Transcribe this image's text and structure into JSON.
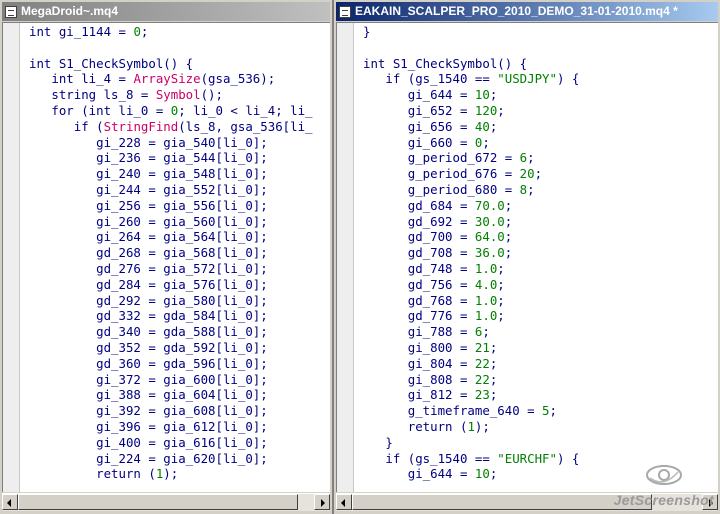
{
  "left_window": {
    "title": "MegaDroid~.mq4",
    "lines": [
      [
        [
          "kw",
          "int gi_1144 = "
        ],
        [
          "num",
          "0"
        ],
        [
          "kw",
          ";"
        ]
      ],
      [],
      [
        [
          "kw",
          "int S1_CheckSymbol() {"
        ]
      ],
      [
        [
          "kw",
          "   int li_4 = "
        ],
        [
          "fn",
          "ArraySize"
        ],
        [
          "kw",
          "(gsa_536);"
        ]
      ],
      [
        [
          "kw",
          "   string ls_8 = "
        ],
        [
          "fn",
          "Symbol"
        ],
        [
          "kw",
          "();"
        ]
      ],
      [
        [
          "kw",
          "   for (int li_0 = "
        ],
        [
          "num",
          "0"
        ],
        [
          "kw",
          "; li_0 < li_4; li_"
        ]
      ],
      [
        [
          "kw",
          "      if ("
        ],
        [
          "fn",
          "StringFind"
        ],
        [
          "kw",
          "(ls_8, gsa_536[li_"
        ]
      ],
      [
        [
          "kw",
          "         gi_228 = gia_540[li_0];"
        ]
      ],
      [
        [
          "kw",
          "         gi_236 = gia_544[li_0];"
        ]
      ],
      [
        [
          "kw",
          "         gi_240 = gia_548[li_0];"
        ]
      ],
      [
        [
          "kw",
          "         gi_244 = gia_552[li_0];"
        ]
      ],
      [
        [
          "kw",
          "         gi_256 = gia_556[li_0];"
        ]
      ],
      [
        [
          "kw",
          "         gi_260 = gia_560[li_0];"
        ]
      ],
      [
        [
          "kw",
          "         gi_264 = gia_564[li_0];"
        ]
      ],
      [
        [
          "kw",
          "         gd_268 = gia_568[li_0];"
        ]
      ],
      [
        [
          "kw",
          "         gd_276 = gia_572[li_0];"
        ]
      ],
      [
        [
          "kw",
          "         gd_284 = gia_576[li_0];"
        ]
      ],
      [
        [
          "kw",
          "         gd_292 = gia_580[li_0];"
        ]
      ],
      [
        [
          "kw",
          "         gd_332 = gda_584[li_0];"
        ]
      ],
      [
        [
          "kw",
          "         gd_340 = gda_588[li_0];"
        ]
      ],
      [
        [
          "kw",
          "         gd_352 = gda_592[li_0];"
        ]
      ],
      [
        [
          "kw",
          "         gd_360 = gda_596[li_0];"
        ]
      ],
      [
        [
          "kw",
          "         gi_372 = gia_600[li_0];"
        ]
      ],
      [
        [
          "kw",
          "         gi_388 = gia_604[li_0];"
        ]
      ],
      [
        [
          "kw",
          "         gi_392 = gia_608[li_0];"
        ]
      ],
      [
        [
          "kw",
          "         gi_396 = gia_612[li_0];"
        ]
      ],
      [
        [
          "kw",
          "         gi_400 = gia_616[li_0];"
        ]
      ],
      [
        [
          "kw",
          "         gi_224 = gia_620[li_0];"
        ]
      ],
      [
        [
          "kw",
          "         return ("
        ],
        [
          "num",
          "1"
        ],
        [
          "kw",
          ");"
        ]
      ]
    ]
  },
  "right_window": {
    "title": "EAKAIN_SCALPER_PRO_2010_DEMO_31-01-2010.mq4 *",
    "lines": [
      [
        [
          "kw",
          "}"
        ]
      ],
      [],
      [
        [
          "kw",
          "int S1_CheckSymbol() {"
        ]
      ],
      [
        [
          "kw",
          "   if (gs_1540 == "
        ],
        [
          "str",
          "\"USDJPY\""
        ],
        [
          "kw",
          ") {"
        ]
      ],
      [
        [
          "kw",
          "      gi_644 = "
        ],
        [
          "num",
          "10"
        ],
        [
          "kw",
          ";"
        ]
      ],
      [
        [
          "kw",
          "      gi_652 = "
        ],
        [
          "num",
          "120"
        ],
        [
          "kw",
          ";"
        ]
      ],
      [
        [
          "kw",
          "      gi_656 = "
        ],
        [
          "num",
          "40"
        ],
        [
          "kw",
          ";"
        ]
      ],
      [
        [
          "kw",
          "      gi_660 = "
        ],
        [
          "num",
          "0"
        ],
        [
          "kw",
          ";"
        ]
      ],
      [
        [
          "kw",
          "      g_period_672 = "
        ],
        [
          "num",
          "6"
        ],
        [
          "kw",
          ";"
        ]
      ],
      [
        [
          "kw",
          "      g_period_676 = "
        ],
        [
          "num",
          "20"
        ],
        [
          "kw",
          ";"
        ]
      ],
      [
        [
          "kw",
          "      g_period_680 = "
        ],
        [
          "num",
          "8"
        ],
        [
          "kw",
          ";"
        ]
      ],
      [
        [
          "kw",
          "      gd_684 = "
        ],
        [
          "num",
          "70.0"
        ],
        [
          "kw",
          ";"
        ]
      ],
      [
        [
          "kw",
          "      gd_692 = "
        ],
        [
          "num",
          "30.0"
        ],
        [
          "kw",
          ";"
        ]
      ],
      [
        [
          "kw",
          "      gd_700 = "
        ],
        [
          "num",
          "64.0"
        ],
        [
          "kw",
          ";"
        ]
      ],
      [
        [
          "kw",
          "      gd_708 = "
        ],
        [
          "num",
          "36.0"
        ],
        [
          "kw",
          ";"
        ]
      ],
      [
        [
          "kw",
          "      gd_748 = "
        ],
        [
          "num",
          "1.0"
        ],
        [
          "kw",
          ";"
        ]
      ],
      [
        [
          "kw",
          "      gd_756 = "
        ],
        [
          "num",
          "4.0"
        ],
        [
          "kw",
          ";"
        ]
      ],
      [
        [
          "kw",
          "      gd_768 = "
        ],
        [
          "num",
          "1.0"
        ],
        [
          "kw",
          ";"
        ]
      ],
      [
        [
          "kw",
          "      gd_776 = "
        ],
        [
          "num",
          "1.0"
        ],
        [
          "kw",
          ";"
        ]
      ],
      [
        [
          "kw",
          "      gi_788 = "
        ],
        [
          "num",
          "6"
        ],
        [
          "kw",
          ";"
        ]
      ],
      [
        [
          "kw",
          "      gi_800 = "
        ],
        [
          "num",
          "21"
        ],
        [
          "kw",
          ";"
        ]
      ],
      [
        [
          "kw",
          "      gi_804 = "
        ],
        [
          "num",
          "22"
        ],
        [
          "kw",
          ";"
        ]
      ],
      [
        [
          "kw",
          "      gi_808 = "
        ],
        [
          "num",
          "22"
        ],
        [
          "kw",
          ";"
        ]
      ],
      [
        [
          "kw",
          "      gi_812 = "
        ],
        [
          "num",
          "23"
        ],
        [
          "kw",
          ";"
        ]
      ],
      [
        [
          "kw",
          "      g_timeframe_640 = "
        ],
        [
          "num",
          "5"
        ],
        [
          "kw",
          ";"
        ]
      ],
      [
        [
          "kw",
          "      return ("
        ],
        [
          "num",
          "1"
        ],
        [
          "kw",
          ");"
        ]
      ],
      [
        [
          "kw",
          "   }"
        ]
      ],
      [
        [
          "kw",
          "   if (gs_1540 == "
        ],
        [
          "str",
          "\"EURCHF\""
        ],
        [
          "kw",
          ") {"
        ]
      ],
      [
        [
          "kw",
          "      gi_644 = "
        ],
        [
          "num",
          "10"
        ],
        [
          "kw",
          ";"
        ]
      ]
    ]
  },
  "watermark": {
    "text": "JetScreenshot"
  },
  "colors": {
    "keyword": "#000080",
    "function": "#cc0066",
    "number": "#008000",
    "string": "#008000"
  }
}
